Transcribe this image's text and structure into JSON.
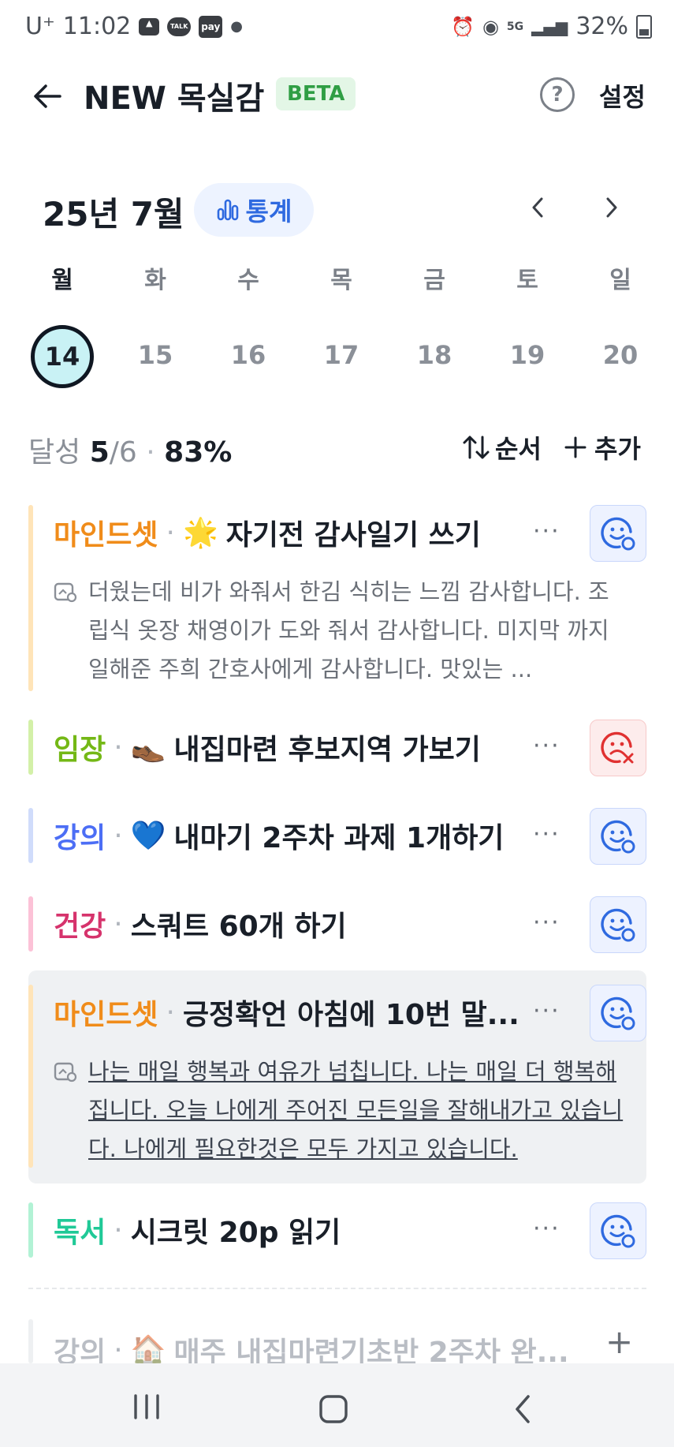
{
  "status_bar": {
    "carrier": "U⁺",
    "time": "11:02",
    "talk_icon": "TALK",
    "pay_icon": "pay",
    "battery": "32%"
  },
  "header": {
    "title": "NEW 목실감",
    "badge": "BETA",
    "settings": "설정"
  },
  "calendar": {
    "month": "25년 7월",
    "stats_label": "통계",
    "weekdays": [
      "월",
      "화",
      "수",
      "목",
      "금",
      "토",
      "일"
    ],
    "dates": [
      "14",
      "15",
      "16",
      "17",
      "18",
      "19",
      "20"
    ]
  },
  "summary": {
    "label": "달성",
    "done": "5",
    "total": "/6",
    "percent": "83%",
    "sort_label": "순서",
    "add_label": "추가"
  },
  "habits": [
    {
      "category": "마인드셋",
      "color": "#f08c1a",
      "emoji": "🌟",
      "name": "자기전 감사일기 쓰기",
      "status": "done",
      "note": "더웠는데 비가 와줘서 한김 식히는 느낌 감사합니다. 조립식 옷장 채영이가 도와 줘서 감사합니다. 미지막 까지 일해준 주희 간호사에게 감사합니다. 맛있는 ..."
    },
    {
      "category": "임장",
      "color": "#74b816",
      "emoji": "👞",
      "name": "내집마련 후보지역 가보기",
      "status": "failed"
    },
    {
      "category": "강의",
      "color": "#4c6ef5",
      "emoji": "💙",
      "name": "내마기 2주차 과제 1개하기",
      "status": "done"
    },
    {
      "category": "건강",
      "color": "#d6336c",
      "emoji": "",
      "name": "스쿼트 60개 하기",
      "status": "done"
    },
    {
      "category": "마인드셋",
      "color": "#f08c1a",
      "emoji": "",
      "name": "긍정확언 아침에 10번 말...",
      "status": "done",
      "note": "나는 매일 행복과 여유가 넘칩니다. 나는 매일 더 행복해집니다. 오늘 나에게 주어진 모든일을 잘해내가고 있습니다. 나에게 필요한것은 모두 가지고 있습니다."
    },
    {
      "category": "독서",
      "color": "#20c997",
      "emoji": "",
      "name": "시크릿 20p 읽기",
      "status": "done"
    },
    {
      "category": "강의",
      "color": "#b9bdc4",
      "emoji": "🏠",
      "name": "매주 내집마련기초반 2주차 완...",
      "status": "inactive"
    }
  ],
  "icons": {
    "back": "arrow-left-icon",
    "help": "question-icon",
    "stats": "bar-chart-icon",
    "prev": "chevron-left-icon",
    "next": "chevron-right-icon",
    "sort": "sort-arrows-icon",
    "add": "plus-icon",
    "more": "more-dots-icon",
    "done": "smile-check-icon",
    "failed": "sad-x-icon",
    "note": "note-icon"
  },
  "more_glyph": "···",
  "plus_glyph": "+",
  "help_glyph": "?"
}
